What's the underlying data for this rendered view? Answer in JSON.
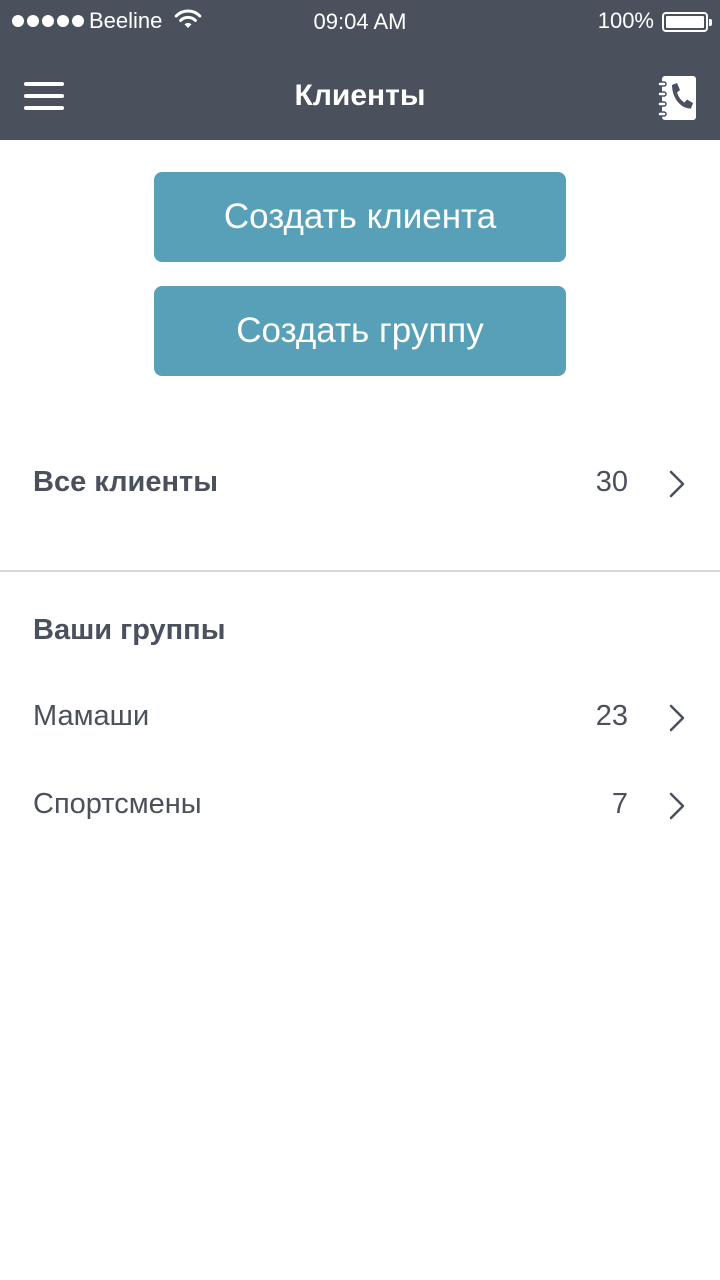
{
  "status_bar": {
    "carrier": "Beeline",
    "time": "09:04 AM",
    "battery": "100%"
  },
  "nav": {
    "title": "Клиенты",
    "menu_icon": "hamburger-menu-icon",
    "contacts_icon": "phone-book-icon"
  },
  "actions": {
    "create_client": "Создать клиента",
    "create_group": "Создать группу"
  },
  "all_clients": {
    "label": "Все клиенты",
    "count": "30"
  },
  "groups": {
    "title": "Ваши группы",
    "items": [
      {
        "label": "Мамаши",
        "count": "23"
      },
      {
        "label": "Спортсмены",
        "count": "7"
      }
    ]
  },
  "colors": {
    "header_bg": "#4a515d",
    "accent_button": "#58a0b8",
    "text": "#4a505c",
    "divider": "#d7d8da"
  }
}
